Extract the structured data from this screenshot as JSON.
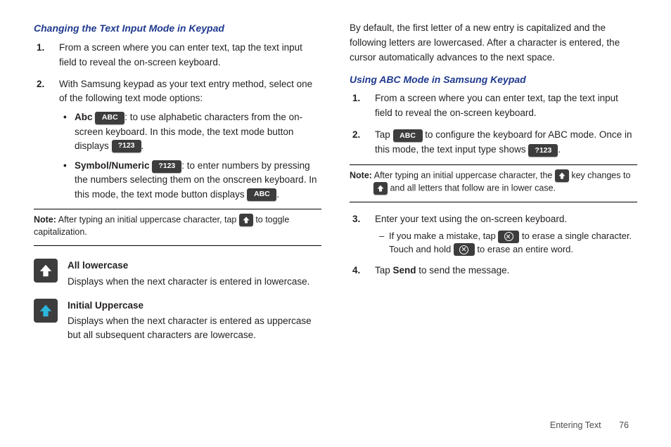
{
  "left": {
    "heading": "Changing the Text Input Mode in Keypad",
    "steps": [
      "From a screen where you can enter text, tap the text input field to reveal the on-screen keyboard.",
      "With Samsung keypad as your text entry method, select one of the following text mode options:"
    ],
    "abc_label": "Abc",
    "abc_desc1": ": to use alphabetic characters from the on-screen keyboard. In this mode, the text mode button displays ",
    "abc_desc2": ".",
    "sym_label": "Symbol/Numeric",
    "sym_desc1": ": to enter numbers by pressing the numbers selecting them on the onscreen keyboard. In this mode, the text mode button displays ",
    "sym_desc2": ".",
    "key_abc": "ABC",
    "key_123": "?123",
    "note1a": "Note:",
    "note1b": " After typing an initial uppercase character, tap ",
    "note1c": " to toggle capitalization.",
    "all_lower_lbl": "All lowercase",
    "all_lower_txt": "Displays when the next character is entered in lowercase.",
    "init_upper_lbl": "Initial Uppercase",
    "init_upper_txt": "Displays when the next character is entered as uppercase but all subsequent characters are lowercase."
  },
  "right": {
    "intro": "By default, the first letter of a new entry is capitalized and the following letters are lowercased. After a character is entered, the cursor automatically advances to the next space.",
    "heading": "Using ABC Mode in Samsung Keypad",
    "step1": "From a screen where you can enter text, tap the text input field to reveal the on-screen keyboard.",
    "step2a": "Tap ",
    "step2b": " to configure the keyboard for ABC mode. Once in this mode, the text input type shows ",
    "step2c": ".",
    "note2a": "Note:",
    "note2b": " After typing an initial uppercase character, the ",
    "note2c": " key changes to ",
    "note2d": " and all letters that follow are in lower case.",
    "step3": "Enter your text using the on-screen keyboard.",
    "sub_a": "If you make a mistake, tap ",
    "sub_b": " to erase a single character. Touch and hold ",
    "sub_c": " to erase an entire word.",
    "step4a": "Tap ",
    "step4_send": "Send",
    "step4b": " to send the message."
  },
  "footer": {
    "section": "Entering Text",
    "page": "76"
  }
}
